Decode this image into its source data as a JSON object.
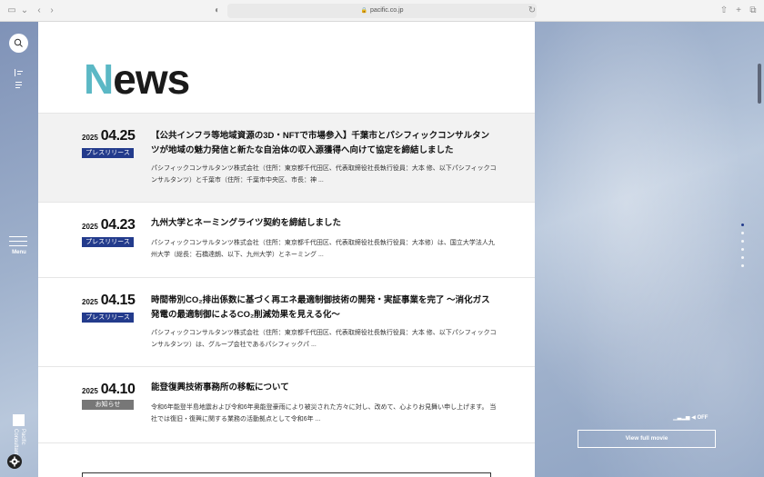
{
  "browser": {
    "url": "pacific.co.jp",
    "icons": [
      "sidebar-icon",
      "chevron-down-icon",
      "back-icon",
      "forward-icon",
      "shield-icon",
      "reload-icon",
      "share-icon",
      "new-tab-icon",
      "tabs-icon"
    ]
  },
  "side": {
    "menu_label": "Menu",
    "logo_text": "Pacific Consultants"
  },
  "page": {
    "title_accent": "N",
    "title_rest": "ews"
  },
  "news": [
    {
      "year": "2025",
      "md": "04.25",
      "badge": "プレスリリース",
      "headline": "【公共インフラ等地域資源の3D・NFTで市場参入】千葉市とパシフィックコンサルタンツが地域の魅力発信と新たな自治体の収入源獲得へ向けて協定を締結しました",
      "excerpt": "パシフィックコンサルタンツ株式会社（住所：東京都千代田区、代表取締役社長執行役員：大本 修、以下パシフィックコンサルタンツ）と千葉市（住所：千葉市中央区、市長：神 ..."
    },
    {
      "year": "2025",
      "md": "04.23",
      "badge": "プレスリリース",
      "headline": "九州大学とネーミングライツ契約を締結しました",
      "excerpt": "パシフィックコンサルタンツ株式会社（住所：東京都千代田区、代表取締役社長執行役員：大本修）は、国立大学法人九州大学（総長：石橋達朗、以下、九州大学）とネーミング ..."
    },
    {
      "year": "2025",
      "md": "04.15",
      "badge": "プレスリリース",
      "headline": "時間帯別CO₂排出係数に基づく再エネ最適制御技術の開発・実証事業を完了 〜消化ガス発電の最適制御によるCO₂削減効果を見える化〜",
      "excerpt": "パシフィックコンサルタンツ株式会社（住所：東京都千代田区、代表取締役社長執行役員：大本 修、以下パシフィックコンサルタンツ）は、グループ会社であるパシフィックパ ..."
    },
    {
      "year": "2025",
      "md": "04.10",
      "badge": "お知らせ",
      "headline": "能登復興技術事務所の移転について",
      "excerpt": "令和6年能登半島地震および令和6年奥能登豪雨により被災された方々に対し、改めて、心よりお見舞い申し上げます。 当社では復旧・復興に関する業務の活動拠点として令和6年 ..."
    }
  ],
  "audio": {
    "label": "OFF"
  },
  "video_button": "View full movie",
  "colors": {
    "accent": "#5bb8c5",
    "press_badge": "#233b8c",
    "notice_badge": "#777777"
  }
}
